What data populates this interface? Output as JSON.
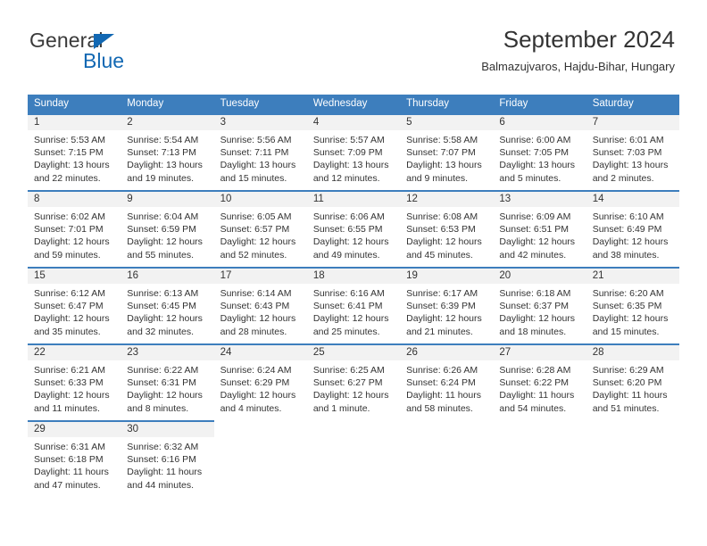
{
  "brand": {
    "name_top": "General",
    "name_bottom": "Blue",
    "triangle_color": "#1268b3",
    "top_color": "#3a3a3a"
  },
  "header": {
    "title": "September 2024",
    "subtitle": "Balmazujvaros, Hajdu-Bihar, Hungary"
  },
  "colors": {
    "header_blue": "#3d7ebd",
    "daynum_band": "#f2f2f2",
    "text": "#333333"
  },
  "weekdays": [
    "Sunday",
    "Monday",
    "Tuesday",
    "Wednesday",
    "Thursday",
    "Friday",
    "Saturday"
  ],
  "weeks": [
    [
      {
        "day": "1",
        "sunrise": "Sunrise: 5:53 AM",
        "sunset": "Sunset: 7:15 PM",
        "daylight": "Daylight: 13 hours and 22 minutes."
      },
      {
        "day": "2",
        "sunrise": "Sunrise: 5:54 AM",
        "sunset": "Sunset: 7:13 PM",
        "daylight": "Daylight: 13 hours and 19 minutes."
      },
      {
        "day": "3",
        "sunrise": "Sunrise: 5:56 AM",
        "sunset": "Sunset: 7:11 PM",
        "daylight": "Daylight: 13 hours and 15 minutes."
      },
      {
        "day": "4",
        "sunrise": "Sunrise: 5:57 AM",
        "sunset": "Sunset: 7:09 PM",
        "daylight": "Daylight: 13 hours and 12 minutes."
      },
      {
        "day": "5",
        "sunrise": "Sunrise: 5:58 AM",
        "sunset": "Sunset: 7:07 PM",
        "daylight": "Daylight: 13 hours and 9 minutes."
      },
      {
        "day": "6",
        "sunrise": "Sunrise: 6:00 AM",
        "sunset": "Sunset: 7:05 PM",
        "daylight": "Daylight: 13 hours and 5 minutes."
      },
      {
        "day": "7",
        "sunrise": "Sunrise: 6:01 AM",
        "sunset": "Sunset: 7:03 PM",
        "daylight": "Daylight: 13 hours and 2 minutes."
      }
    ],
    [
      {
        "day": "8",
        "sunrise": "Sunrise: 6:02 AM",
        "sunset": "Sunset: 7:01 PM",
        "daylight": "Daylight: 12 hours and 59 minutes."
      },
      {
        "day": "9",
        "sunrise": "Sunrise: 6:04 AM",
        "sunset": "Sunset: 6:59 PM",
        "daylight": "Daylight: 12 hours and 55 minutes."
      },
      {
        "day": "10",
        "sunrise": "Sunrise: 6:05 AM",
        "sunset": "Sunset: 6:57 PM",
        "daylight": "Daylight: 12 hours and 52 minutes."
      },
      {
        "day": "11",
        "sunrise": "Sunrise: 6:06 AM",
        "sunset": "Sunset: 6:55 PM",
        "daylight": "Daylight: 12 hours and 49 minutes."
      },
      {
        "day": "12",
        "sunrise": "Sunrise: 6:08 AM",
        "sunset": "Sunset: 6:53 PM",
        "daylight": "Daylight: 12 hours and 45 minutes."
      },
      {
        "day": "13",
        "sunrise": "Sunrise: 6:09 AM",
        "sunset": "Sunset: 6:51 PM",
        "daylight": "Daylight: 12 hours and 42 minutes."
      },
      {
        "day": "14",
        "sunrise": "Sunrise: 6:10 AM",
        "sunset": "Sunset: 6:49 PM",
        "daylight": "Daylight: 12 hours and 38 minutes."
      }
    ],
    [
      {
        "day": "15",
        "sunrise": "Sunrise: 6:12 AM",
        "sunset": "Sunset: 6:47 PM",
        "daylight": "Daylight: 12 hours and 35 minutes."
      },
      {
        "day": "16",
        "sunrise": "Sunrise: 6:13 AM",
        "sunset": "Sunset: 6:45 PM",
        "daylight": "Daylight: 12 hours and 32 minutes."
      },
      {
        "day": "17",
        "sunrise": "Sunrise: 6:14 AM",
        "sunset": "Sunset: 6:43 PM",
        "daylight": "Daylight: 12 hours and 28 minutes."
      },
      {
        "day": "18",
        "sunrise": "Sunrise: 6:16 AM",
        "sunset": "Sunset: 6:41 PM",
        "daylight": "Daylight: 12 hours and 25 minutes."
      },
      {
        "day": "19",
        "sunrise": "Sunrise: 6:17 AM",
        "sunset": "Sunset: 6:39 PM",
        "daylight": "Daylight: 12 hours and 21 minutes."
      },
      {
        "day": "20",
        "sunrise": "Sunrise: 6:18 AM",
        "sunset": "Sunset: 6:37 PM",
        "daylight": "Daylight: 12 hours and 18 minutes."
      },
      {
        "day": "21",
        "sunrise": "Sunrise: 6:20 AM",
        "sunset": "Sunset: 6:35 PM",
        "daylight": "Daylight: 12 hours and 15 minutes."
      }
    ],
    [
      {
        "day": "22",
        "sunrise": "Sunrise: 6:21 AM",
        "sunset": "Sunset: 6:33 PM",
        "daylight": "Daylight: 12 hours and 11 minutes."
      },
      {
        "day": "23",
        "sunrise": "Sunrise: 6:22 AM",
        "sunset": "Sunset: 6:31 PM",
        "daylight": "Daylight: 12 hours and 8 minutes."
      },
      {
        "day": "24",
        "sunrise": "Sunrise: 6:24 AM",
        "sunset": "Sunset: 6:29 PM",
        "daylight": "Daylight: 12 hours and 4 minutes."
      },
      {
        "day": "25",
        "sunrise": "Sunrise: 6:25 AM",
        "sunset": "Sunset: 6:27 PM",
        "daylight": "Daylight: 12 hours and 1 minute."
      },
      {
        "day": "26",
        "sunrise": "Sunrise: 6:26 AM",
        "sunset": "Sunset: 6:24 PM",
        "daylight": "Daylight: 11 hours and 58 minutes."
      },
      {
        "day": "27",
        "sunrise": "Sunrise: 6:28 AM",
        "sunset": "Sunset: 6:22 PM",
        "daylight": "Daylight: 11 hours and 54 minutes."
      },
      {
        "day": "28",
        "sunrise": "Sunrise: 6:29 AM",
        "sunset": "Sunset: 6:20 PM",
        "daylight": "Daylight: 11 hours and 51 minutes."
      }
    ],
    [
      {
        "day": "29",
        "sunrise": "Sunrise: 6:31 AM",
        "sunset": "Sunset: 6:18 PM",
        "daylight": "Daylight: 11 hours and 47 minutes."
      },
      {
        "day": "30",
        "sunrise": "Sunrise: 6:32 AM",
        "sunset": "Sunset: 6:16 PM",
        "daylight": "Daylight: 11 hours and 44 minutes."
      },
      null,
      null,
      null,
      null,
      null
    ]
  ]
}
